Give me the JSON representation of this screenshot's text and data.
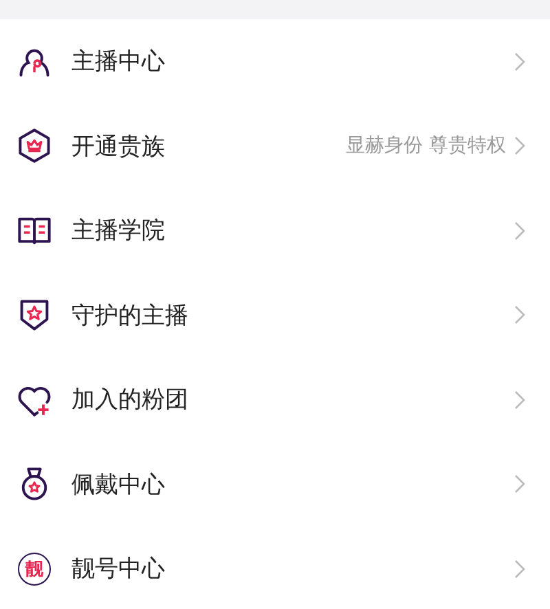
{
  "menu": [
    {
      "kind": "person",
      "label": "主播中心"
    },
    {
      "kind": "crown",
      "label": "开通贵族",
      "hint": "显赫身份 尊贵特权"
    },
    {
      "kind": "book",
      "label": "主播学院"
    },
    {
      "kind": "shield",
      "label": "守护的主播"
    },
    {
      "kind": "heart",
      "label": "加入的粉团"
    },
    {
      "kind": "medal",
      "label": "佩戴中心"
    },
    {
      "kind": "glyph",
      "label": "靓号中心",
      "glyph": "靓"
    }
  ]
}
